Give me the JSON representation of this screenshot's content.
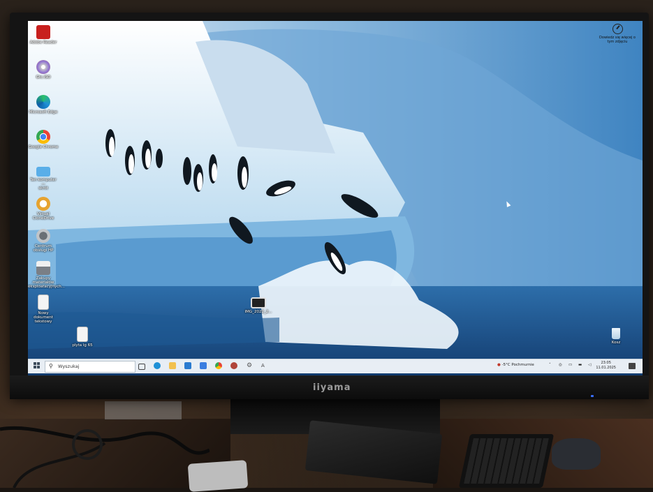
{
  "monitor": {
    "brand": "iiyama"
  },
  "desktop_icons": [
    {
      "label": "Adobe Reader",
      "icon": "acrobat-icon",
      "color": "#c8201e"
    },
    {
      "label": "Gtc.ISO",
      "icon": "disc-icon",
      "color": "#d0d0d0"
    },
    {
      "label": "Microsoft Edge",
      "icon": "edge-icon",
      "color": "#1e90d6"
    },
    {
      "label": "Google Chrome",
      "icon": "chrome-icon",
      "color": "#ea4335"
    },
    {
      "label": "Ten komputer —\nskrót",
      "icon": "computer-icon",
      "color": "#5aaee8"
    },
    {
      "label": "Virtual CloneDrive",
      "icon": "sheep-icon",
      "color": "#e6a330"
    },
    {
      "label": "Centrum obsługi HP",
      "icon": "hp-icon",
      "color": "#9aa0a6"
    },
    {
      "label": "Zakupy materiałów\neksploatacyjnych...",
      "icon": "printer-icon",
      "color": "#8a8f96"
    },
    {
      "label": "Nowy dokument\ntekstowy",
      "icon": "text-file-icon",
      "color": "#f2f2f2"
    },
    {
      "label": "plyta lg 65",
      "icon": "file-icon",
      "color": "#f2f2f2"
    }
  ],
  "center_icon": {
    "label": "IMG_2022_2...",
    "icon": "monitor-file-icon"
  },
  "recycle_bin": {
    "label": "Kosz",
    "icon": "recycle-bin-icon"
  },
  "overlay": {
    "text": "Dowiedz się więcej o\ntym zdjęciu",
    "icon": "info-camera-icon"
  },
  "taskbar": {
    "search_placeholder": "Wyszukaj",
    "weather": "-5°C  Pochmurnie",
    "time": "23:05",
    "date": "11.01.2025",
    "apps": [
      {
        "name": "task-view-icon",
        "color": "#444444"
      },
      {
        "name": "edge-icon",
        "color": "#1e90d6"
      },
      {
        "name": "file-explorer-icon",
        "color": "#f2c14e"
      },
      {
        "name": "outlook-icon",
        "color": "#2a7bd0"
      },
      {
        "name": "store-icon",
        "color": "#3a7de0"
      },
      {
        "name": "chrome-icon",
        "color": "#ea4335"
      },
      {
        "name": "app-icon",
        "color": "#b0453a"
      },
      {
        "name": "settings-icon",
        "color": "#555555"
      },
      {
        "name": "ai-icon",
        "color": "#444444"
      }
    ]
  }
}
